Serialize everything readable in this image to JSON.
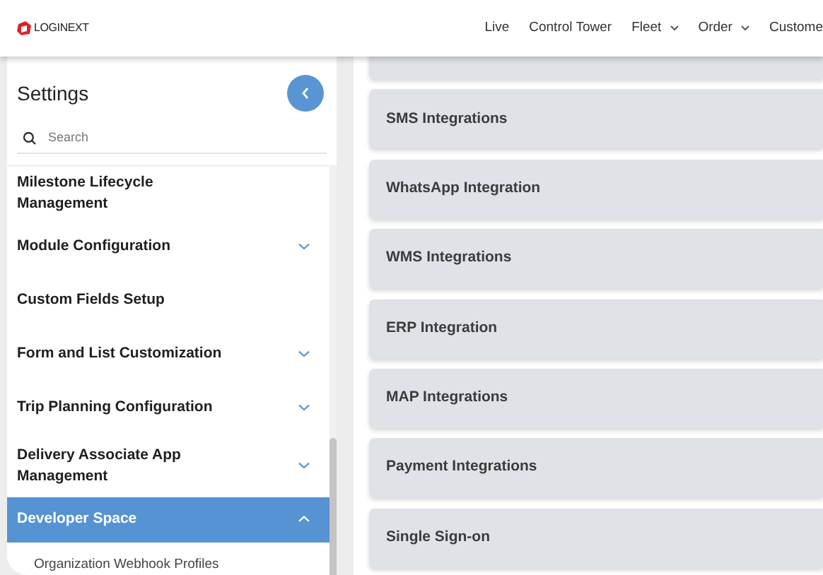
{
  "header": {
    "logo": "LOGINEXT",
    "nav": [
      {
        "label": "Live",
        "dropdown": false
      },
      {
        "label": "Control Tower",
        "dropdown": false
      },
      {
        "label": "Fleet",
        "dropdown": true
      },
      {
        "label": "Order",
        "dropdown": true
      },
      {
        "label": "Custome",
        "dropdown": false
      }
    ]
  },
  "sidebar": {
    "title": "Settings",
    "search": {
      "placeholder": "Search"
    },
    "items": [
      {
        "label": "Milestone Lifecycle Management",
        "kind": "link",
        "selected": false
      },
      {
        "label": "Module Configuration",
        "kind": "group",
        "expanded": false,
        "selected": false
      },
      {
        "label": "Custom Fields Setup",
        "kind": "link",
        "selected": false
      },
      {
        "label": "Form and List Customization",
        "kind": "group",
        "expanded": false,
        "selected": false
      },
      {
        "label": "Trip Planning Configuration",
        "kind": "group",
        "expanded": false,
        "selected": false
      },
      {
        "label": "Delivery Associate App Management",
        "kind": "group",
        "expanded": false,
        "selected": false
      },
      {
        "label": "Developer Space",
        "kind": "group",
        "expanded": true,
        "selected": true,
        "children": [
          {
            "label": "Organization Webhook Profiles"
          }
        ]
      }
    ]
  },
  "integrations": [
    {
      "label": "SMS Integrations"
    },
    {
      "label": "WhatsApp Integration"
    },
    {
      "label": "WMS Integrations"
    },
    {
      "label": "ERP Integration"
    },
    {
      "label": "MAP Integrations"
    },
    {
      "label": "Payment Integrations"
    },
    {
      "label": "Single Sign-on"
    }
  ]
}
